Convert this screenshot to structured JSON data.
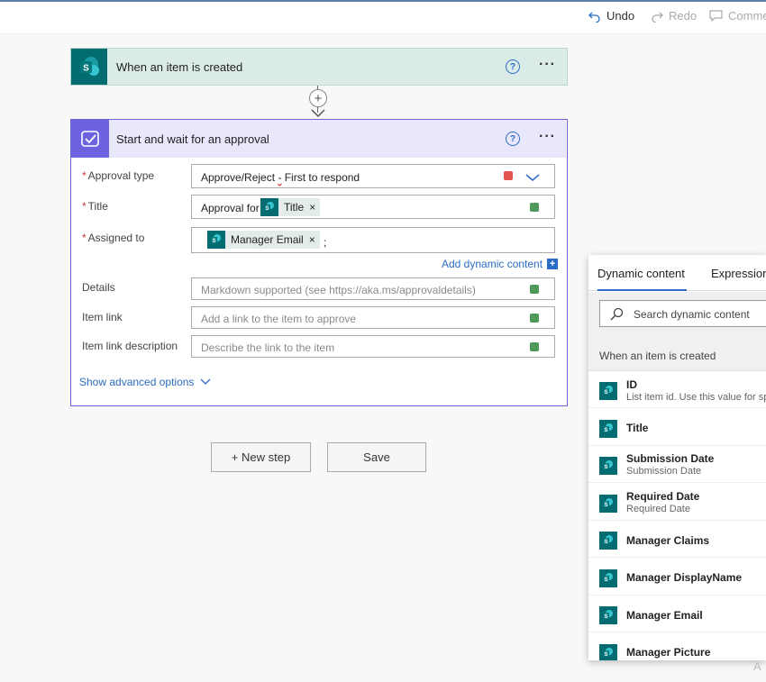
{
  "toolbar": {
    "undo": "Undo",
    "redo": "Redo",
    "comments": "Comme"
  },
  "trigger": {
    "title": "When an item is created",
    "help": "?",
    "more": "···"
  },
  "connector": {
    "plus": "+"
  },
  "approval": {
    "title": "Start and wait for an approval",
    "help": "?",
    "more": "···",
    "required_mark": "*",
    "approval_type": {
      "label": "Approval type",
      "value_prefix": "Approve/Reject ",
      "value_dash": "-",
      "value_suffix": " First to respond"
    },
    "title_field": {
      "label": "Title",
      "prefix": "Approval for",
      "token": "Title"
    },
    "assigned_to": {
      "label": "Assigned to",
      "token": "Manager Email",
      "suffix": ";"
    },
    "add_dynamic": "Add dynamic content",
    "add_dynamic_plus": "+",
    "details": {
      "label": "Details",
      "placeholder": "Markdown supported (see https://aka.ms/approvaldetails)"
    },
    "item_link": {
      "label": "Item link",
      "placeholder": "Add a link to the item to approve"
    },
    "item_link_description": {
      "label": "Item link description",
      "placeholder": "Describe the link to the item"
    },
    "show_advanced": "Show advanced options",
    "token_remove": "×"
  },
  "buttons": {
    "new_step": "+ New step",
    "save": "Save"
  },
  "panel": {
    "tabs": [
      "Dynamic content",
      "Expression"
    ],
    "search_placeholder": "Search dynamic content",
    "section": "When an item is created",
    "items": [
      {
        "name": "ID",
        "desc": "List item id. Use this value for sp"
      },
      {
        "name": "Title",
        "desc": ""
      },
      {
        "name": "Submission Date",
        "desc": "Submission Date"
      },
      {
        "name": "Required Date",
        "desc": "Required Date"
      },
      {
        "name": "Manager Claims",
        "desc": ""
      },
      {
        "name": "Manager DisplayName",
        "desc": ""
      },
      {
        "name": "Manager Email",
        "desc": ""
      },
      {
        "name": "Manager Picture",
        "desc": ""
      }
    ]
  },
  "corner_text": "A",
  "icons": {
    "sharepoint": "sharepoint-icon",
    "approval": "approval-icon",
    "undo": "undo-icon",
    "redo": "redo-icon",
    "comment": "comment-icon",
    "search": "search-icon",
    "chevron": "chevron-down-icon"
  },
  "colors": {
    "sharepoint_teal": "#036c70",
    "approval_purple": "#6d63e0",
    "link_blue": "#2b6cc4",
    "trigger_bg": "#dbebe7",
    "approval_header_bg": "#e8e7fb"
  }
}
